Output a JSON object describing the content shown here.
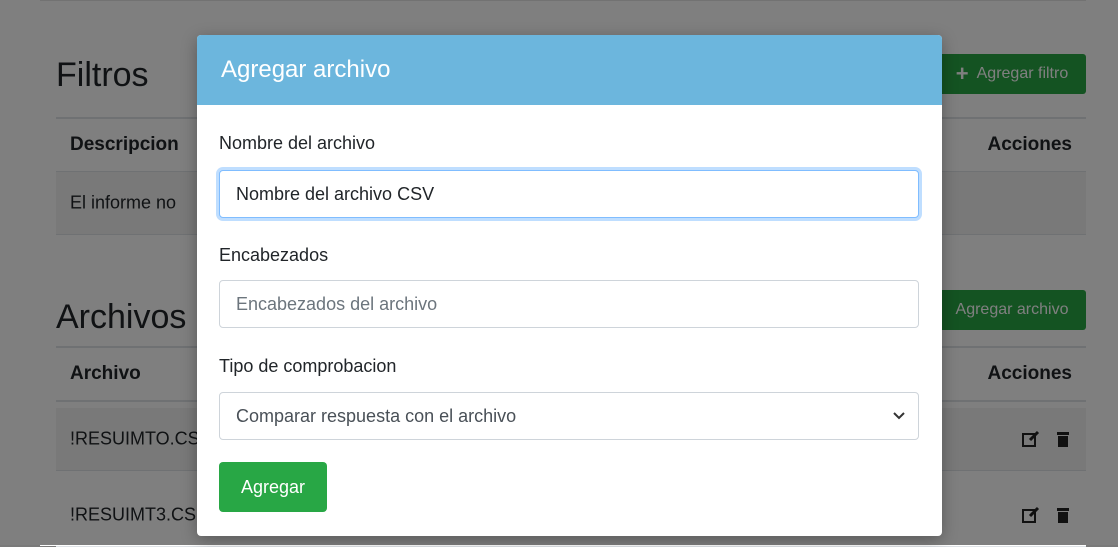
{
  "filters": {
    "title": "Filtros",
    "add_button": "Agregar filtro",
    "columns": {
      "description": "Descripcion",
      "actions": "Acciones"
    },
    "empty_row": "El informe no"
  },
  "files": {
    "title": "Archivos",
    "add_button": "Agregar archivo",
    "columns": {
      "file": "Archivo",
      "actions": "Acciones"
    },
    "rows": [
      {
        "name": "!RESUIMTO.CS"
      },
      {
        "name": "!RESUIMT3.CS"
      }
    ]
  },
  "modal": {
    "title": "Agregar archivo",
    "name_label": "Nombre del archivo",
    "name_value": "Nombre del archivo CSV",
    "headers_label": "Encabezados",
    "headers_placeholder": "Encabezados del archivo",
    "check_label": "Tipo de comprobacion",
    "check_selected": "Comparar respuesta con el archivo",
    "submit": "Agregar"
  },
  "icons": {
    "edit": "edit-icon",
    "delete": "trash-icon",
    "plus": "plus-icon",
    "dropdown": "chevron-down-icon"
  },
  "colors": {
    "header": "#6cb6dd",
    "success": "#28a745",
    "focus": "#80bdff"
  }
}
